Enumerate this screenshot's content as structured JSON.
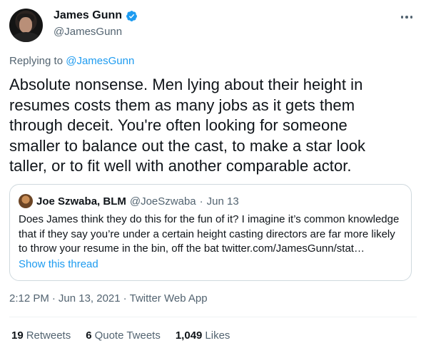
{
  "author": {
    "display_name": "James Gunn",
    "handle": "@JamesGunn",
    "verified": true
  },
  "replying": {
    "prefix": "Replying to",
    "target": "@JamesGunn"
  },
  "tweet": {
    "lines": [
      "Absolute nonsense. Men lying about their height in",
      "resumes costs them as many jobs as it gets them",
      "through deceit. You're often looking for someone",
      "smaller to balance out the cast, to make a star look",
      "taller, or to fit well with another comparable actor."
    ]
  },
  "quote": {
    "name": "Joe Szwaba, BLM",
    "handle": "@JoeSzwaba",
    "separator": "·",
    "date": "Jun 13",
    "lines": [
      "Does James think they do this for the fun of it? I imagine it’s common knowledge",
      "that if they say you’re under a certain height casting directors are far more likely",
      "to throw your resume in the bin, off the bat twitter.com/JamesGunn/stat…"
    ],
    "show_thread": "Show this thread"
  },
  "meta": {
    "time": "2:12 PM",
    "sep1": "·",
    "date": "Jun 13, 2021",
    "sep2": "·",
    "app": "Twitter Web App"
  },
  "stats": {
    "retweets_count": "19",
    "retweets_label": "Retweets",
    "quotes_count": "6",
    "quotes_label": "Quote Tweets",
    "likes_count": "1,049",
    "likes_label": "Likes"
  },
  "icons": {
    "verified": "verified-badge-icon",
    "more": "more-options-icon"
  },
  "colors": {
    "accent": "#1d9bf0",
    "secondary_text": "#536471",
    "border": "#cfd9de"
  }
}
